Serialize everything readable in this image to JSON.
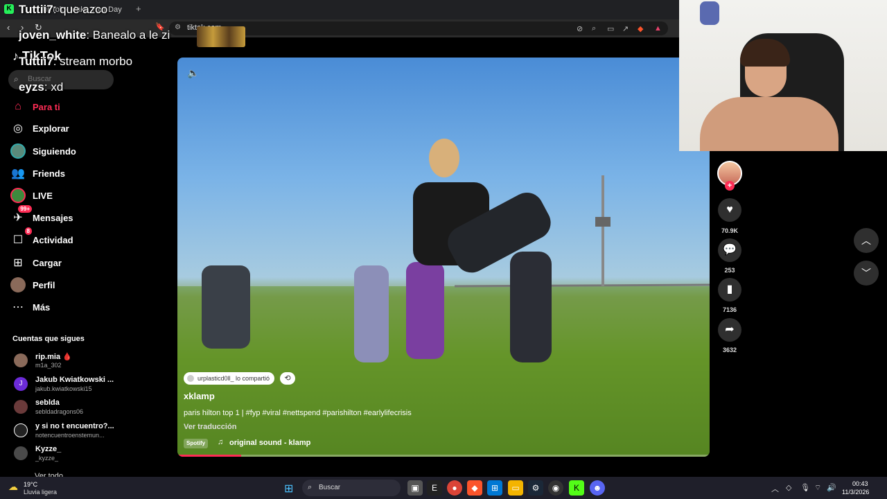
{
  "browser": {
    "tab_title": "TikTok - Make Your Day",
    "tab_icon": "K",
    "new_tab": "+",
    "url": "tiktok.com",
    "back": "‹",
    "forward": "›",
    "reload": "↻"
  },
  "sidebar": {
    "logo": "TikTok",
    "search_placeholder": "Buscar",
    "items": [
      {
        "label": "Para ti",
        "icon": "home-icon",
        "active": true
      },
      {
        "label": "Explorar",
        "icon": "compass-icon"
      },
      {
        "label": "Siguiendo",
        "icon": "avatar-icon"
      },
      {
        "label": "Friends",
        "icon": "friends-icon"
      },
      {
        "label": "LIVE",
        "icon": "live-icon"
      },
      {
        "label": "Mensajes",
        "icon": "messages-icon",
        "badge": "99+"
      },
      {
        "label": "Actividad",
        "icon": "activity-icon",
        "badge": "8"
      },
      {
        "label": "Cargar",
        "icon": "upload-icon"
      },
      {
        "label": "Perfil",
        "icon": "profile-icon"
      },
      {
        "label": "Más",
        "icon": "more-icon"
      }
    ],
    "following_title": "Cuentas que sigues",
    "accounts": [
      {
        "name": "rip.mia 🩸",
        "handle": "m1a_302",
        "color": "#8a6a5a"
      },
      {
        "name": "Jakub Kwiatkowski ...",
        "handle": "jakub.kwiatkowski15",
        "color": "#6c2bd9",
        "initial": "J"
      },
      {
        "name": "seblda",
        "handle": "sebldadragons06",
        "color": "#6a3a3a"
      },
      {
        "name": "y si no t encuentro?...",
        "handle": "notencuentroenstemun...",
        "color": "#222"
      },
      {
        "name": "Kyzze_",
        "handle": "_kyzze_",
        "color": "#4a4a4a"
      }
    ],
    "see_all": "Ver todo"
  },
  "video": {
    "mute_icon": "🔈",
    "shared_by": "urplasticd0ll_ lo compartió",
    "repost_icon": "⟲",
    "author": "xklamp",
    "caption": "paris hilton top 1 | #fyp #viral #nettspend #parishilton #earlylifecrisis",
    "translate": "Ver traducción",
    "spotify": "Spotify",
    "music_icon": "♫",
    "sound": "original sound - klamp",
    "progress": 0.12
  },
  "actions": {
    "likes": "70.9K",
    "comments": "253",
    "saves": "7136",
    "shares": "3632",
    "follow": "+"
  },
  "chat": [
    {
      "user": "Tuttii7",
      "msg": ": que azco"
    },
    {
      "user": "joven_white",
      "msg": ": Banealo a le zi"
    },
    {
      "user": "Tuttii7",
      "msg": ": stream morbo"
    },
    {
      "user": "eyzs",
      "msg": ": xd"
    }
  ],
  "taskbar": {
    "temp": "19°C",
    "condition": "Lluvia ligera",
    "search": "Buscar",
    "time": "00:43",
    "date": "11/3/2026"
  }
}
